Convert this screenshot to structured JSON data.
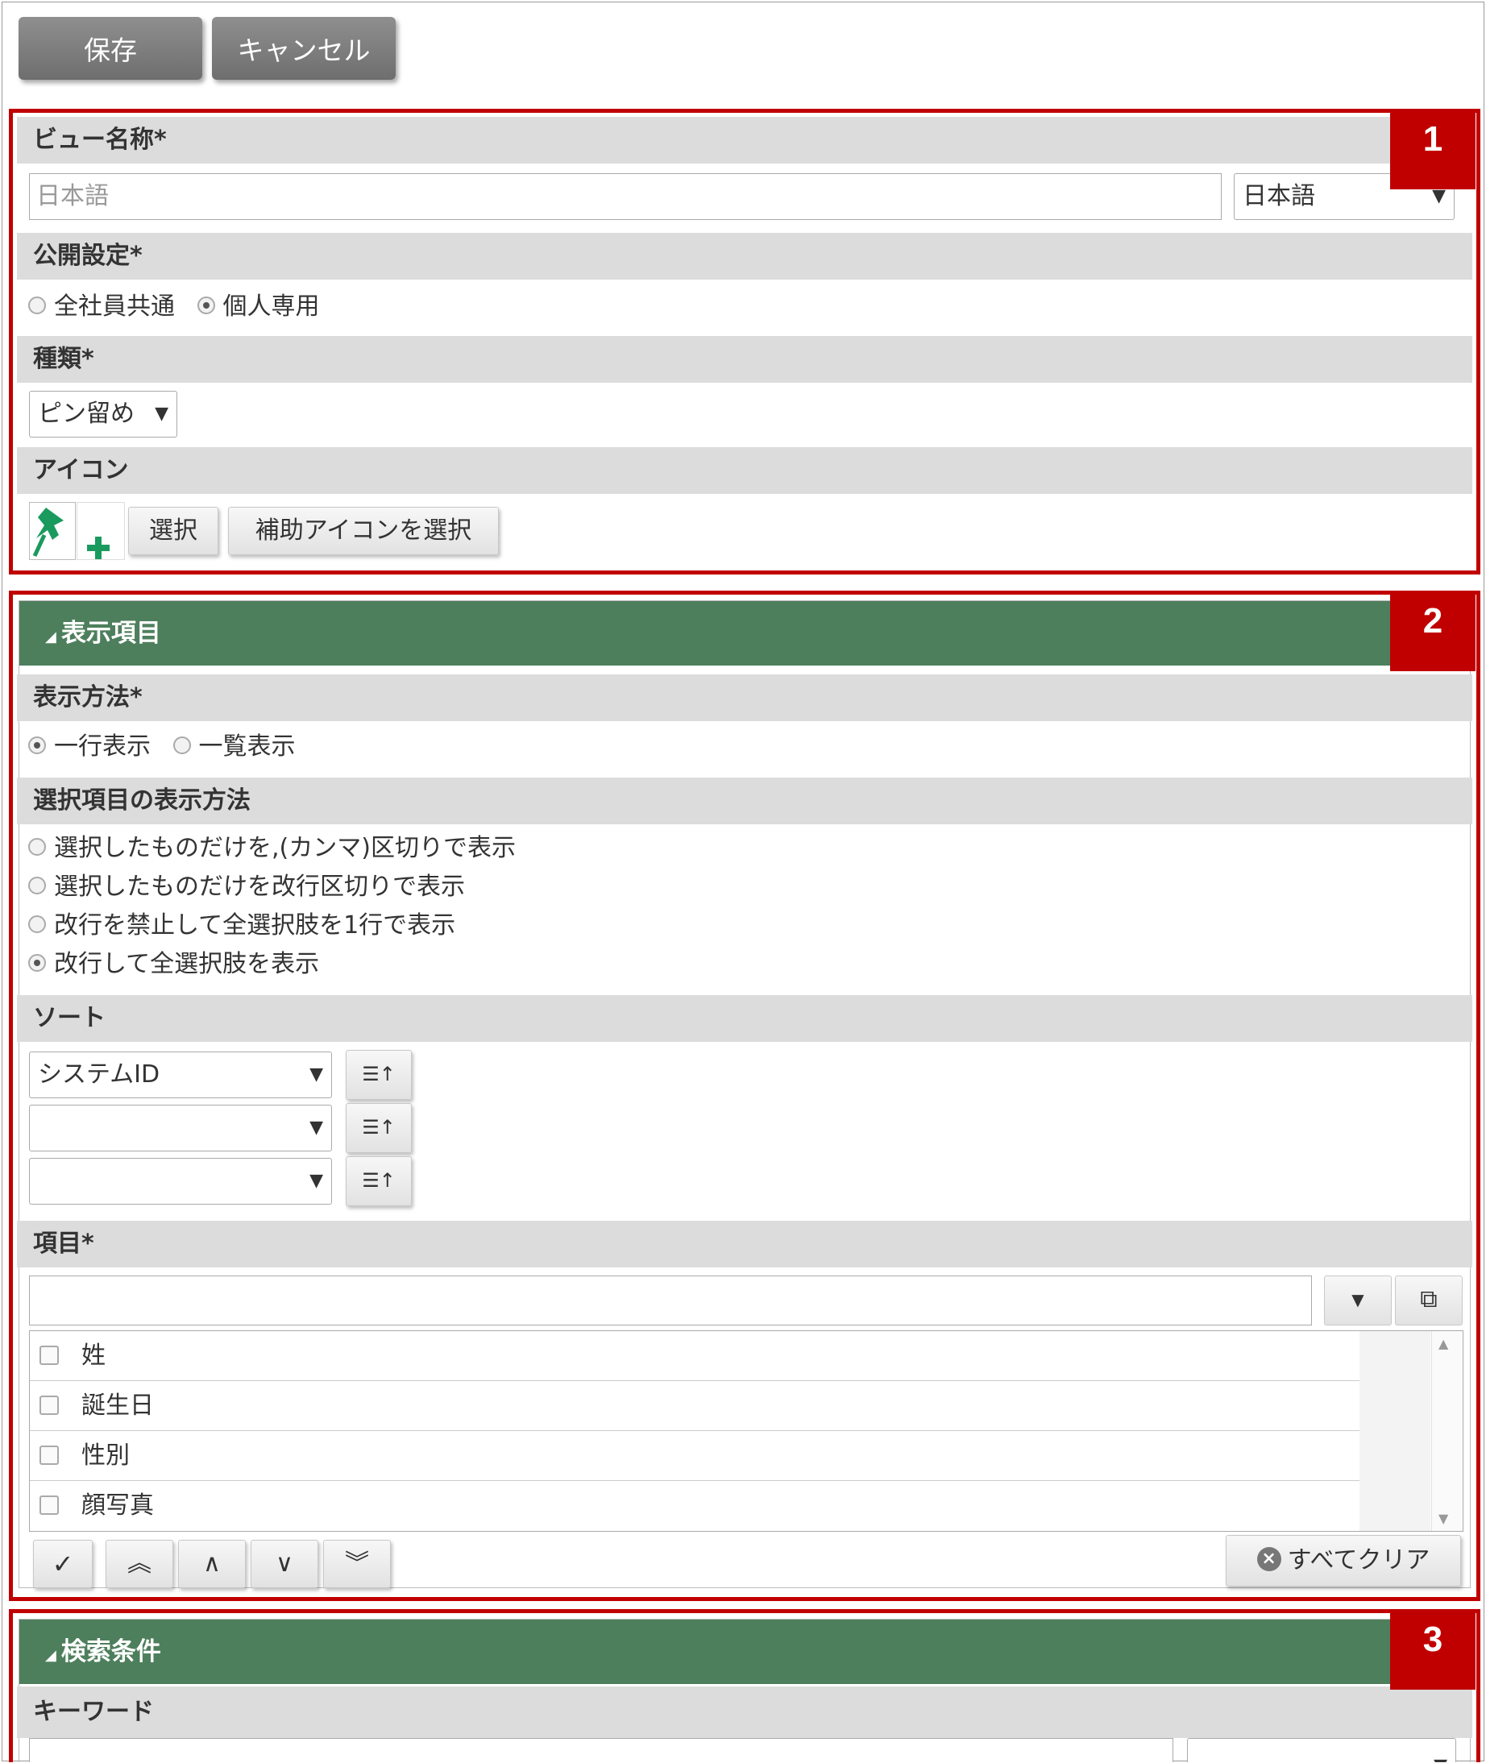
{
  "toolbar": {
    "save_label": "保存",
    "cancel_label": "キャンセル"
  },
  "badges": [
    "1",
    "2",
    "3"
  ],
  "section1": {
    "view_name_label": "ビュー名称*",
    "view_name_placeholder": "日本語",
    "view_name_lang_select": "日本語",
    "visibility_label": "公開設定*",
    "visibility_options": [
      {
        "label": "全社員共通",
        "selected": false
      },
      {
        "label": "個人専用",
        "selected": true
      }
    ],
    "type_label": "種類*",
    "type_select": "ピン留め",
    "icon_label": "アイコン",
    "icon_select_button": "選択",
    "icon_sub_button": "補助アイコンを選択"
  },
  "section2": {
    "header": "表示項目",
    "display_method_label": "表示方法*",
    "display_method_options": [
      {
        "label": "一行表示",
        "selected": true
      },
      {
        "label": "一覧表示",
        "selected": false
      }
    ],
    "choice_display_label": "選択項目の表示方法",
    "choice_display_options": [
      {
        "label": "選択したものだけを,(カンマ)区切りで表示",
        "selected": false
      },
      {
        "label": "選択したものだけを改行区切りで表示",
        "selected": false
      },
      {
        "label": "改行を禁止して全選択肢を1行で表示",
        "selected": false
      },
      {
        "label": "改行して全選択肢を表示",
        "selected": true
      }
    ],
    "sort_label": "ソート",
    "sort_selects": [
      "システムID",
      "",
      ""
    ],
    "items_label": "項目*",
    "items_input_value": "",
    "items_list": [
      "姓",
      "誕生日",
      "性別",
      "顔写真"
    ],
    "clear_all_button": "すべてクリア"
  },
  "section3": {
    "header": "検索条件",
    "keyword_label": "キーワード"
  },
  "colors": {
    "accent_red": "#c00000",
    "header_green": "#4e7f5d",
    "label_gray": "#dcdcdc"
  }
}
